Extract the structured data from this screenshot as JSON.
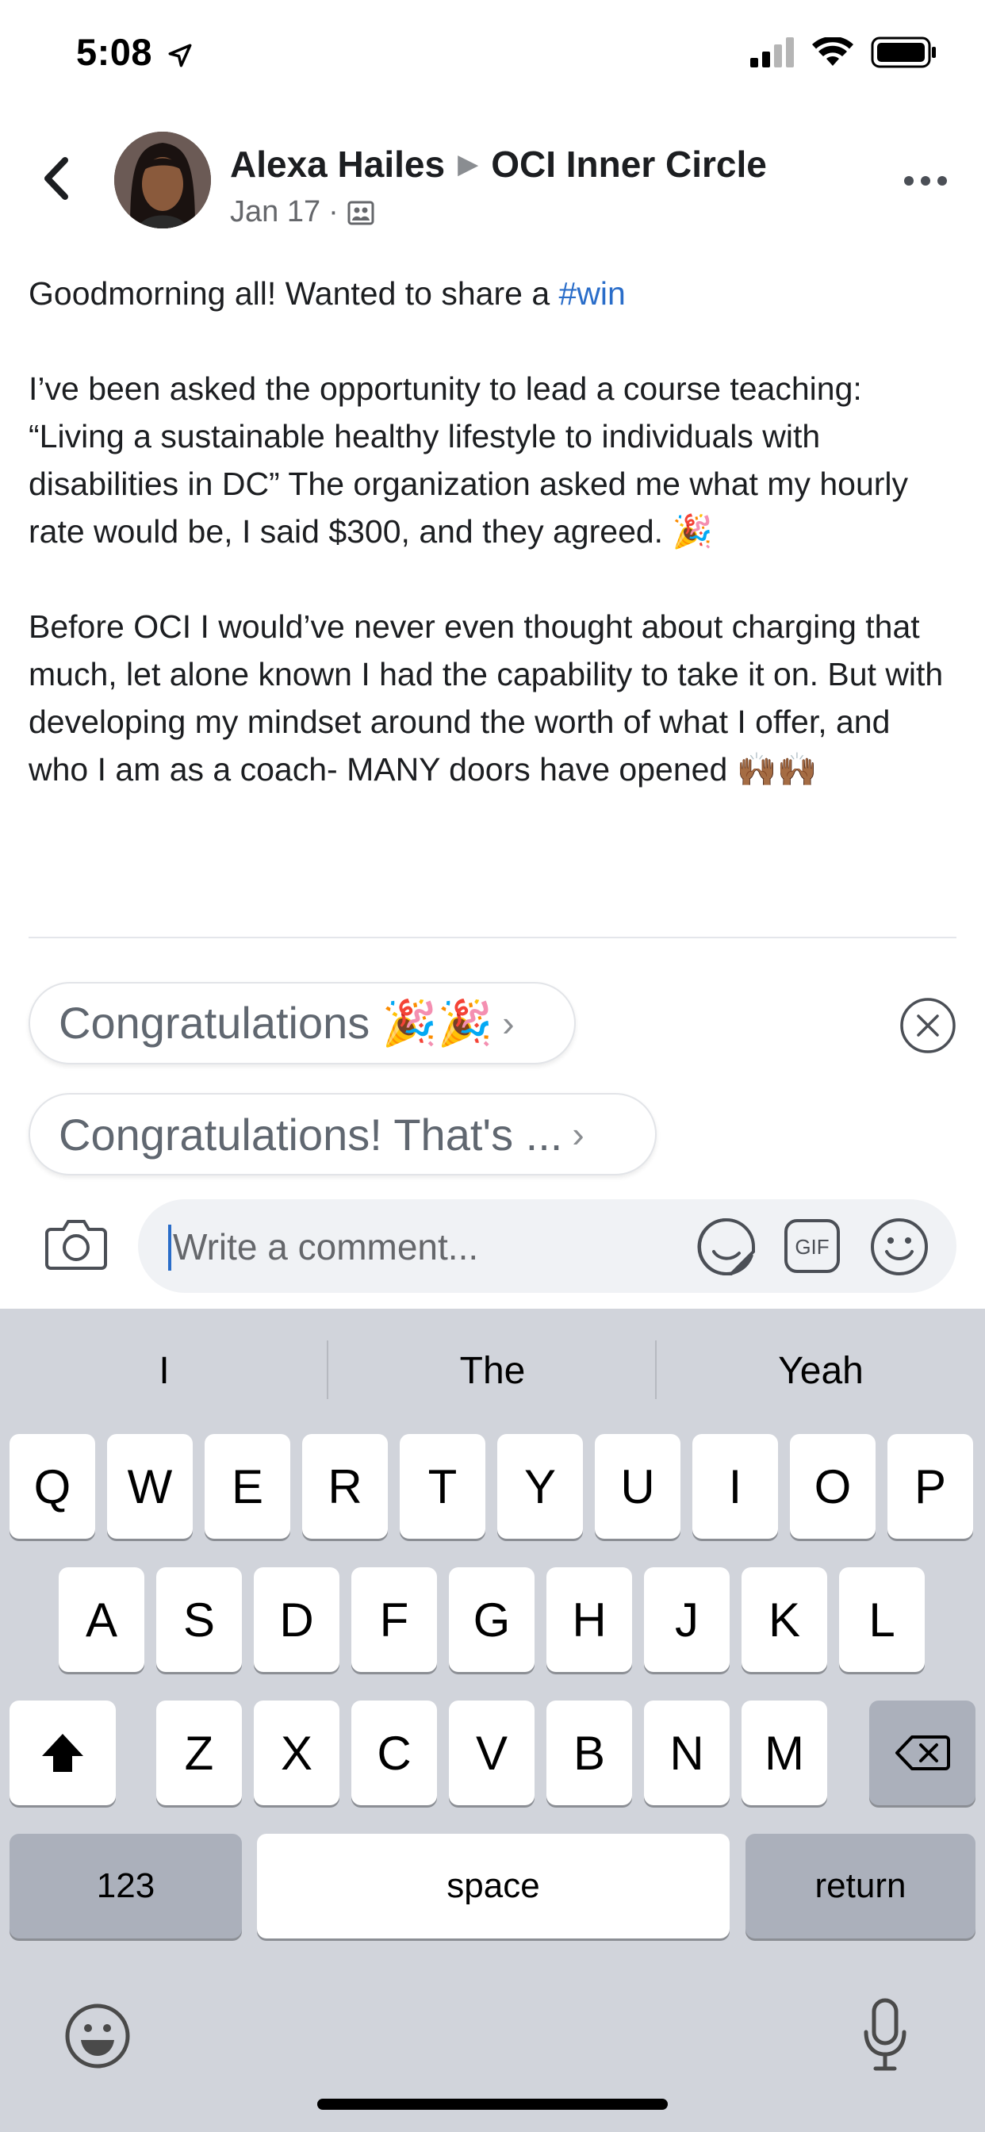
{
  "status_bar": {
    "time": "5:08"
  },
  "post": {
    "author": "Alexa Hailes",
    "group": "OCI Inner Circle",
    "date": "Jan 17",
    "meta_separator": "·",
    "paragraphs": {
      "p1_text": "Goodmorning all! Wanted to share a ",
      "p1_hashtag": "#win",
      "p2": "I’ve been asked the opportunity to lead a course teaching: “Living a sustainable healthy lifestyle to individuals with disabilities in DC” The organization asked me what my hourly rate would be, I said $300, and they agreed. 🎉",
      "p3": "Before OCI I would’ve never even thought about charging that much, let alone known I had the capability to take it on. But with developing my mindset around the worth of what I offer, and who I am as a coach- MANY doors have opened 🙌🏾🙌🏾"
    }
  },
  "suggestions": [
    {
      "label": "Congratulations 🎉🎉"
    },
    {
      "label": "Congratulations! That's ..."
    }
  ],
  "composer": {
    "placeholder": "Write a comment..."
  },
  "keyboard": {
    "predictions": [
      "I",
      "The",
      "Yeah"
    ],
    "row1": [
      "Q",
      "W",
      "E",
      "R",
      "T",
      "Y",
      "U",
      "I",
      "O",
      "P"
    ],
    "row2": [
      "A",
      "S",
      "D",
      "F",
      "G",
      "H",
      "J",
      "K",
      "L"
    ],
    "row3": [
      "Z",
      "X",
      "C",
      "V",
      "B",
      "N",
      "M"
    ],
    "numbers_label": "123",
    "space_label": "space",
    "return_label": "return"
  },
  "colors": {
    "accent": "#2a6dc9",
    "keyboard_bg": "#d1d4db"
  },
  "icons": [
    "location-arrow-icon",
    "signal-icon",
    "wifi-icon",
    "battery-icon",
    "back-chevron-icon",
    "group-icon",
    "more-icon",
    "close-circle-icon",
    "camera-icon",
    "sticker-icon",
    "gif-icon",
    "smiley-icon",
    "shift-icon",
    "delete-icon",
    "emoji-keyboard-icon",
    "microphone-icon"
  ]
}
